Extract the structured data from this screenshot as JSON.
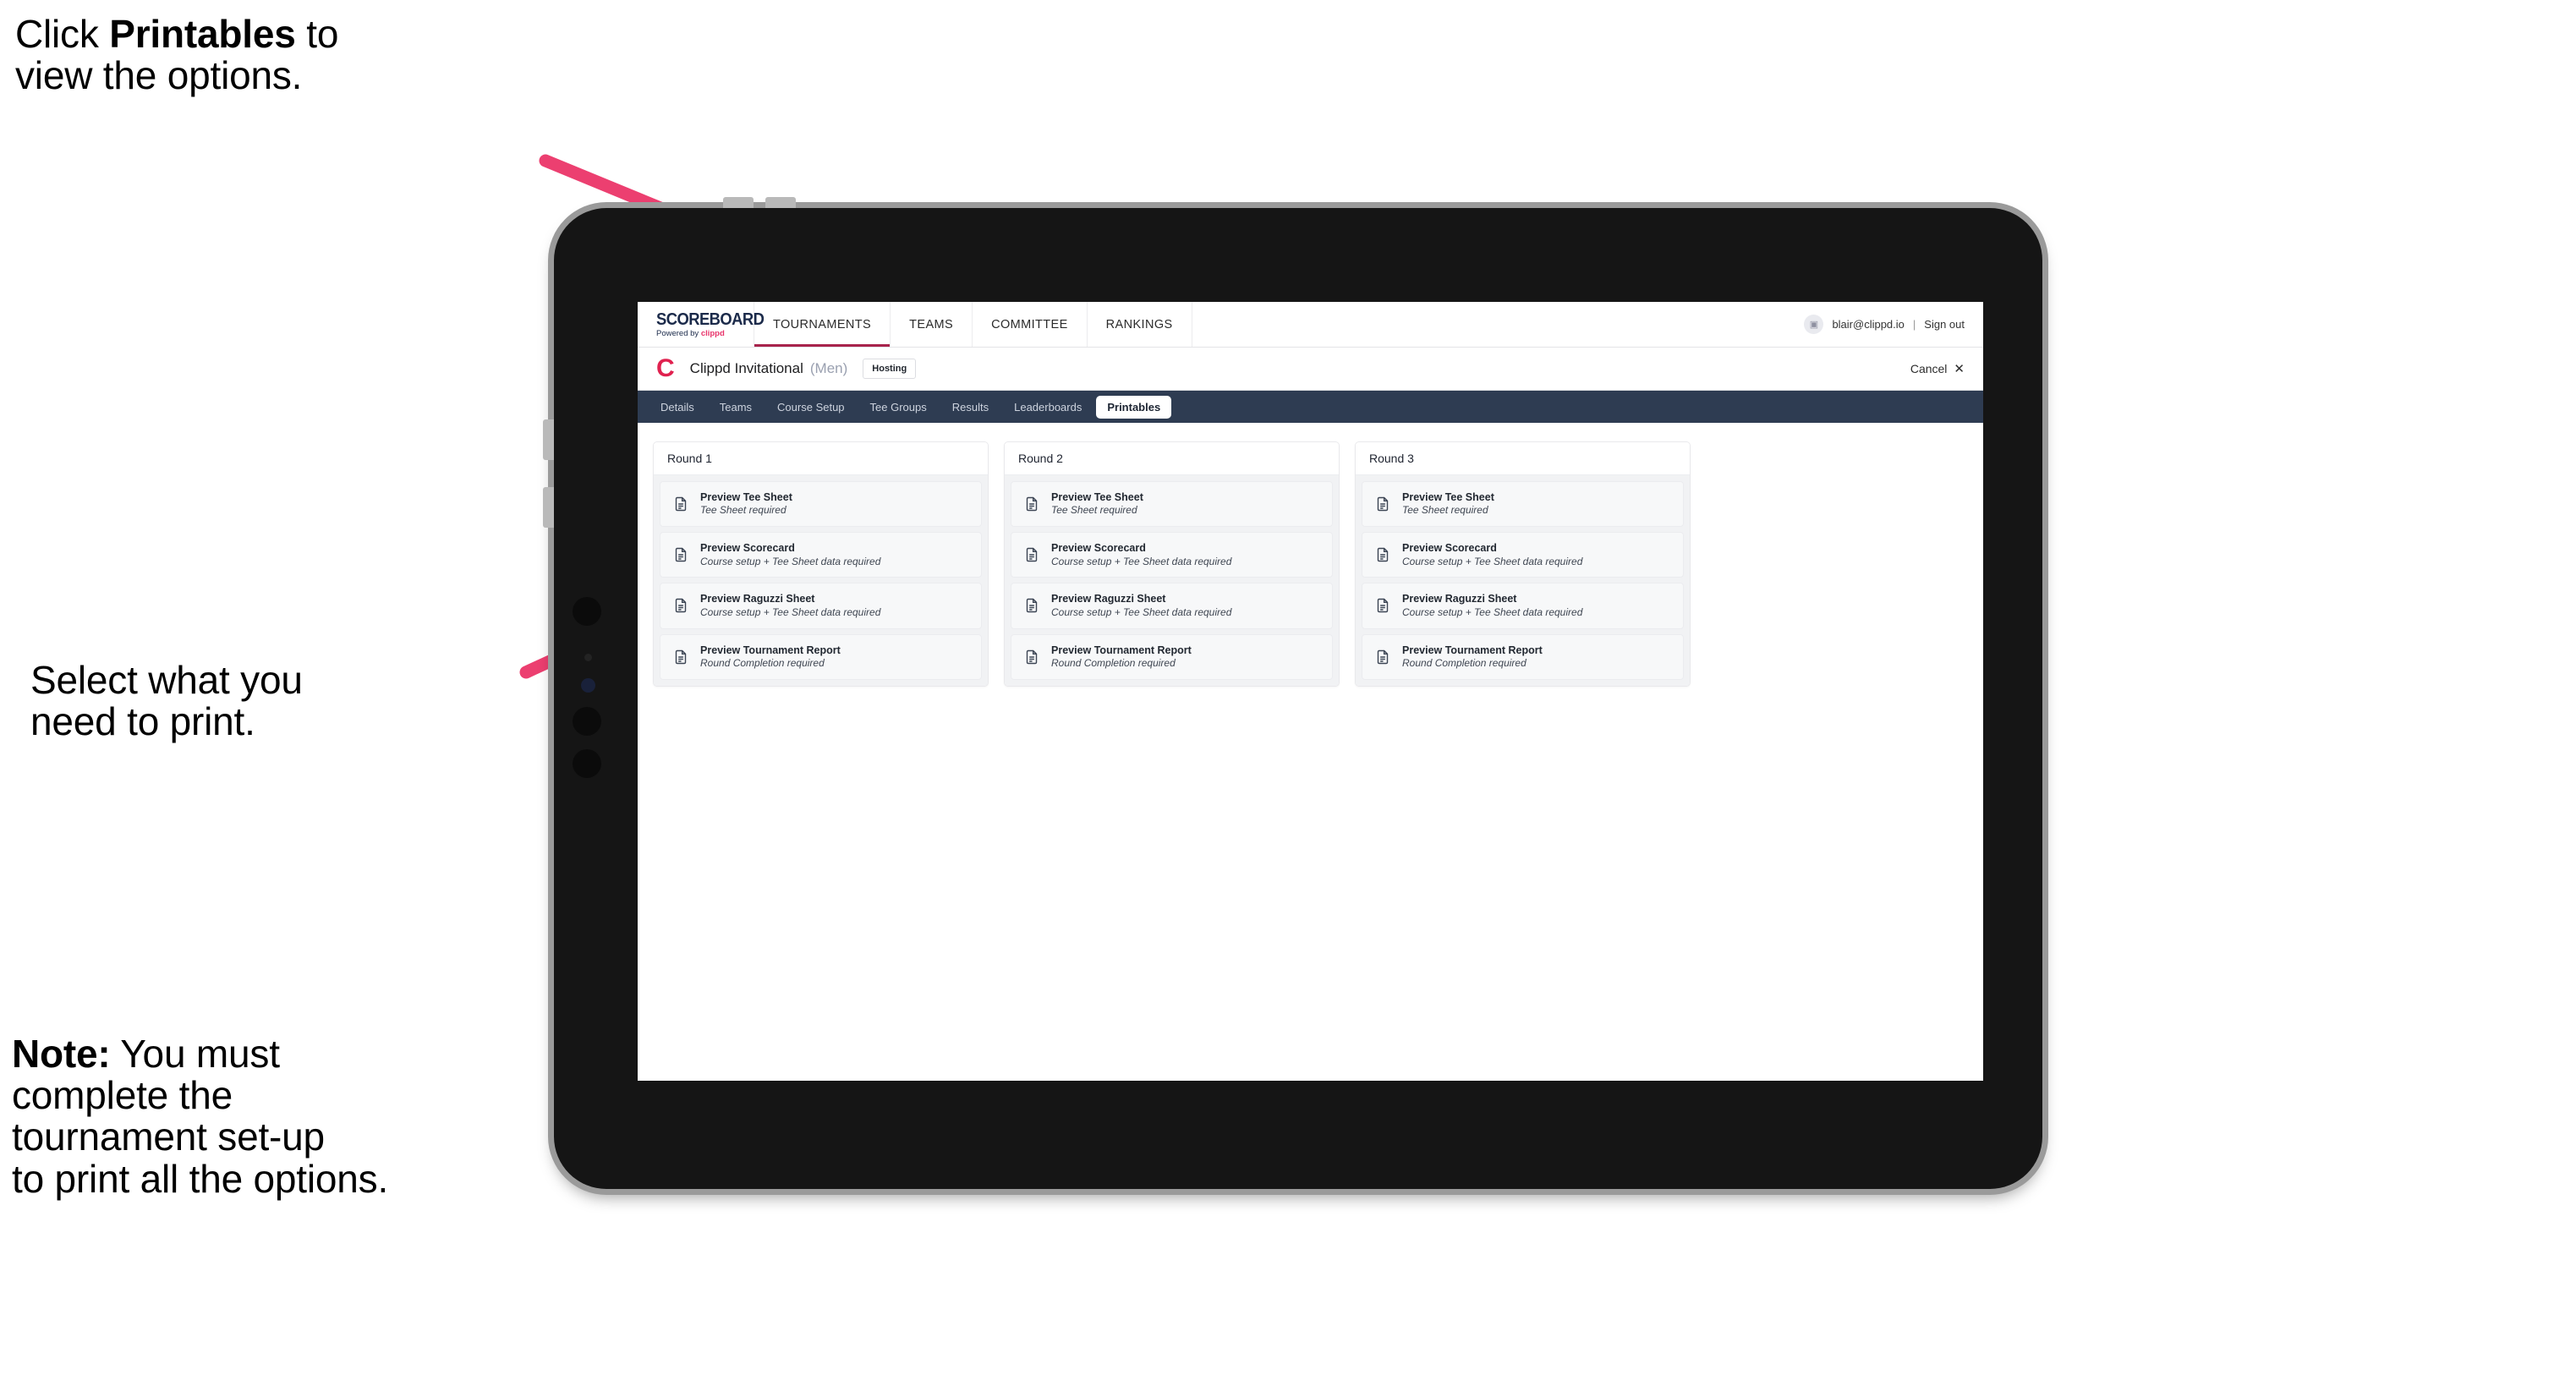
{
  "annotations": {
    "printables_tip_prefix": "Click ",
    "printables_tip_bold": "Printables",
    "printables_tip_suffix": " to\nview the options.",
    "select_tip": "Select what you\n need to print.",
    "note_bold": "Note:",
    "note_text": " You must\ncomplete the\ntournament set-up\nto print all the options."
  },
  "accent_colors": {
    "arrow_pink": "#ec3f70",
    "brand_pink": "#e0214f",
    "nav_navy": "#2e3c52",
    "tournaments_underline": "#a8234c"
  },
  "app": {
    "brand": {
      "logo_word": "SCOREBOARD",
      "logo_sub_prefix": "Powered by ",
      "logo_sub_accent": "clippd"
    },
    "top_nav": [
      {
        "label": "TOURNAMENTS",
        "active": true
      },
      {
        "label": "TEAMS",
        "active": false
      },
      {
        "label": "COMMITTEE",
        "active": false
      },
      {
        "label": "RANKINGS",
        "active": false
      }
    ],
    "account": {
      "avatar_glyph": "▣",
      "email": "blair@clippd.io",
      "separator": "|",
      "sign_out": "Sign out"
    },
    "tournament": {
      "logo_letter": "C",
      "name": "Clippd Invitational",
      "gender": "(Men)",
      "status": "Hosting",
      "cancel_label": "Cancel",
      "cancel_icon": "✕"
    },
    "tabs": [
      {
        "label": "Details",
        "active": false
      },
      {
        "label": "Teams",
        "active": false
      },
      {
        "label": "Course Setup",
        "active": false
      },
      {
        "label": "Tee Groups",
        "active": false
      },
      {
        "label": "Results",
        "active": false
      },
      {
        "label": "Leaderboards",
        "active": false
      },
      {
        "label": "Printables",
        "active": true
      }
    ],
    "rounds": [
      {
        "title": "Round 1",
        "items": [
          {
            "title": "Preview Tee Sheet",
            "sub": "Tee Sheet required"
          },
          {
            "title": "Preview Scorecard",
            "sub": "Course setup + Tee Sheet data required"
          },
          {
            "title": "Preview Raguzzi Sheet",
            "sub": "Course setup + Tee Sheet data required"
          },
          {
            "title": "Preview Tournament Report",
            "sub": "Round Completion required"
          }
        ]
      },
      {
        "title": "Round 2",
        "items": [
          {
            "title": "Preview Tee Sheet",
            "sub": "Tee Sheet required"
          },
          {
            "title": "Preview Scorecard",
            "sub": "Course setup + Tee Sheet data required"
          },
          {
            "title": "Preview Raguzzi Sheet",
            "sub": "Course setup + Tee Sheet data required"
          },
          {
            "title": "Preview Tournament Report",
            "sub": "Round Completion required"
          }
        ]
      },
      {
        "title": "Round 3",
        "items": [
          {
            "title": "Preview Tee Sheet",
            "sub": "Tee Sheet required"
          },
          {
            "title": "Preview Scorecard",
            "sub": "Course setup + Tee Sheet data required"
          },
          {
            "title": "Preview Raguzzi Sheet",
            "sub": "Course setup + Tee Sheet data required"
          },
          {
            "title": "Preview Tournament Report",
            "sub": "Round Completion required"
          }
        ]
      }
    ]
  }
}
